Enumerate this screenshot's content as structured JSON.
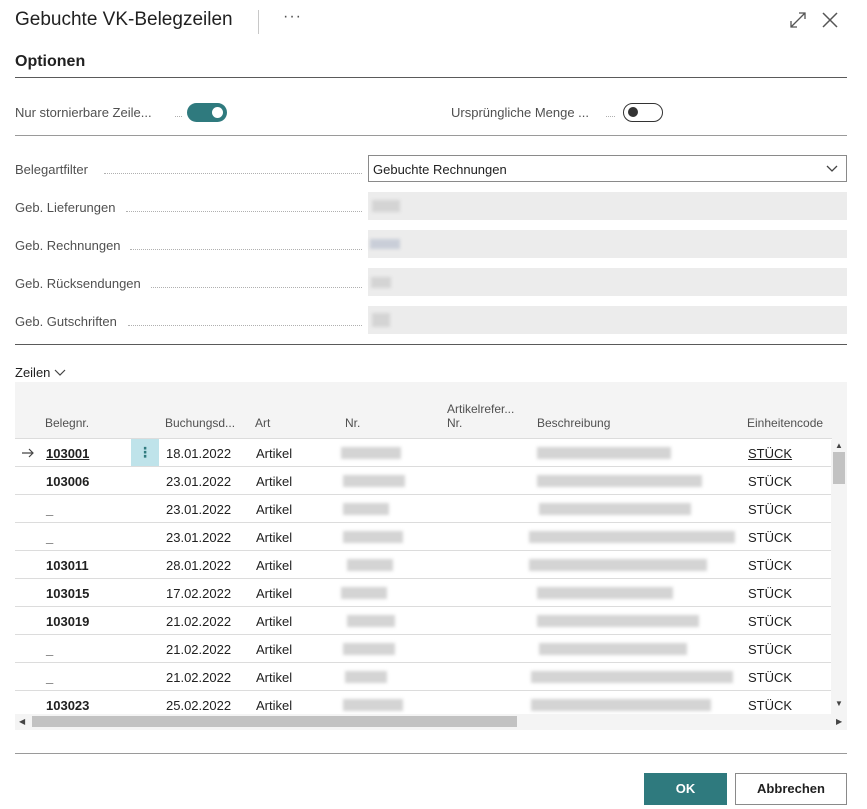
{
  "dialog": {
    "title": "Gebuchte VK-Belegzeilen",
    "more_label": "···"
  },
  "options": {
    "section_title": "Optionen",
    "toggle_cancelable_label": "Nur stornierbare Zeile...",
    "toggle_cancelable_on": true,
    "toggle_original_qty_label": "Ursprüngliche Menge ...",
    "toggle_original_qty_on": false,
    "doc_type_filter_label": "Belegartfilter",
    "doc_type_filter_value": "Gebuchte Rechnungen",
    "shipments_label": "Geb. Lieferungen",
    "invoices_label": "Geb. Rechnungen",
    "returns_label": "Geb. Rücksendungen",
    "credit_memos_label": "Geb. Gutschriften"
  },
  "lines": {
    "section_label": "Zeilen",
    "columns": {
      "doc_no": "Belegnr.",
      "posting_date": "Buchungsd...",
      "type": "Art",
      "no": "Nr.",
      "item_ref_1": "Artikelrefer...",
      "item_ref_2": "Nr.",
      "description": "Beschreibung",
      "uom": "Einheitencode"
    },
    "rows": [
      {
        "doc_no": "103001",
        "date": "18.01.2022",
        "type": "Artikel",
        "uom": "STÜCK"
      },
      {
        "doc_no": "103006",
        "date": "23.01.2022",
        "type": "Artikel",
        "uom": "STÜCK"
      },
      {
        "doc_no": "_",
        "date": "23.01.2022",
        "type": "Artikel",
        "uom": "STÜCK"
      },
      {
        "doc_no": "_",
        "date": "23.01.2022",
        "type": "Artikel",
        "uom": "STÜCK"
      },
      {
        "doc_no": "103011",
        "date": "28.01.2022",
        "type": "Artikel",
        "uom": "STÜCK"
      },
      {
        "doc_no": "103015",
        "date": "17.02.2022",
        "type": "Artikel",
        "uom": "STÜCK"
      },
      {
        "doc_no": "103019",
        "date": "21.02.2022",
        "type": "Artikel",
        "uom": "STÜCK"
      },
      {
        "doc_no": "_",
        "date": "21.02.2022",
        "type": "Artikel",
        "uom": "STÜCK"
      },
      {
        "doc_no": "_",
        "date": "21.02.2022",
        "type": "Artikel",
        "uom": "STÜCK"
      },
      {
        "doc_no": "103023",
        "date": "25.02.2022",
        "type": "Artikel",
        "uom": "STÜCK"
      }
    ]
  },
  "footer": {
    "ok_label": "OK",
    "cancel_label": "Abbrechen"
  },
  "colors": {
    "accent": "#2f7a7e",
    "active_cell": "#bfe3ea"
  }
}
